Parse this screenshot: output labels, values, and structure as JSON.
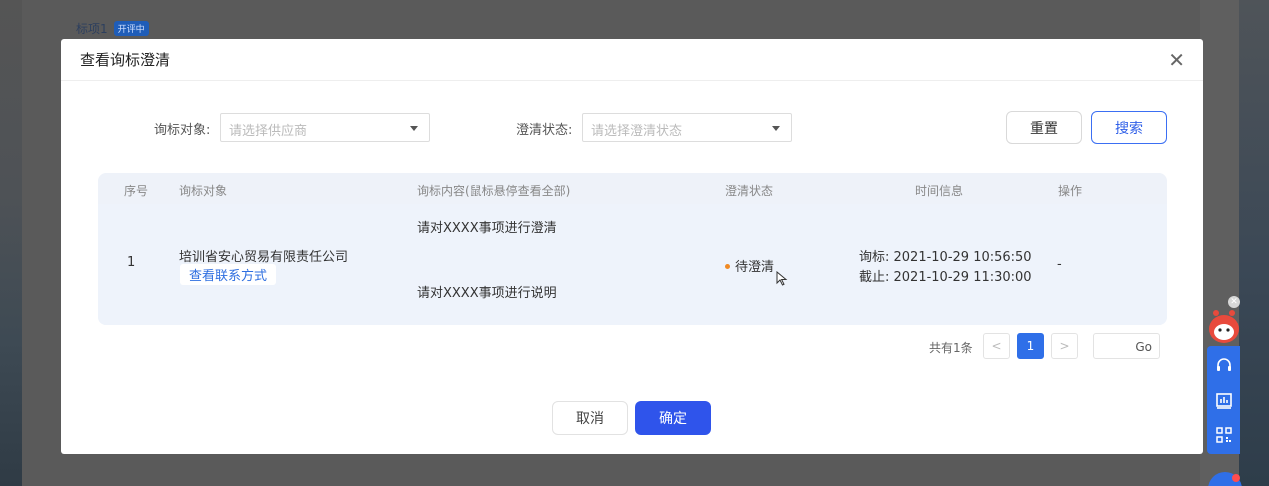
{
  "background": {
    "breadcrumb_title": "标项1",
    "breadcrumb_badge": "开评中"
  },
  "modal": {
    "title": "查看询标澄清",
    "close_icon": "close-icon"
  },
  "filters": {
    "target_label": "询标对象:",
    "target_placeholder": "请选择供应商",
    "status_label": "澄清状态:",
    "status_placeholder": "请选择澄清状态",
    "reset_label": "重置",
    "search_label": "搜索"
  },
  "table": {
    "columns": [
      "序号",
      "询标对象",
      "询标内容(鼠标悬停查看全部)",
      "澄清状态",
      "时间信息",
      "操作"
    ],
    "rows": [
      {
        "index": "1",
        "target": "培训省安心贸易有限责任公司",
        "contact_link": "查看联系方式",
        "content_1": "请对XXXX事项进行澄清",
        "content_2": "请对XXXX事项进行说明",
        "status": "待澄清",
        "status_color": "#f08a24",
        "time_inquiry": "询标: 2021-10-29 10:56:50",
        "time_deadline": "截止: 2021-10-29 11:30:00",
        "action": "-"
      }
    ]
  },
  "pagination": {
    "total_text": "共有1条",
    "prev": "<",
    "current_page": "1",
    "next": ">",
    "go_label": "Go"
  },
  "footer": {
    "cancel_label": "取消",
    "confirm_label": "确定"
  },
  "colors": {
    "primary": "#2f54eb",
    "link": "#2f6fe0",
    "pending": "#f08a24"
  }
}
